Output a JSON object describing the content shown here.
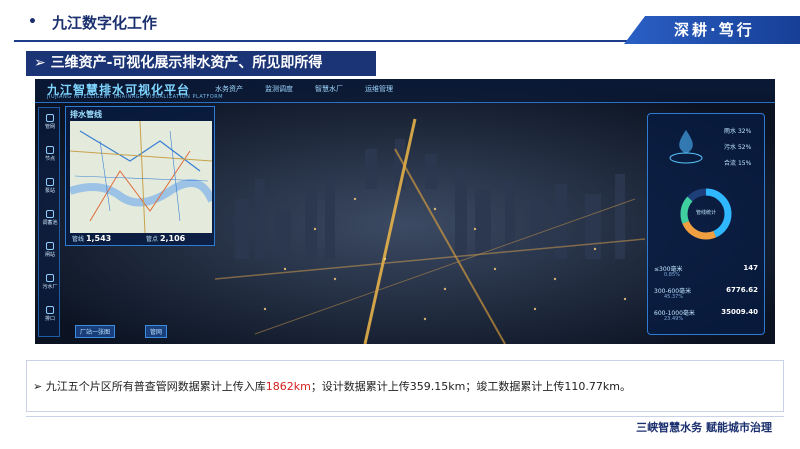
{
  "header": {
    "bullet": "•",
    "title": "九江数字化工作",
    "tag": "深耕·笃行"
  },
  "section": {
    "arrow": "➢",
    "title": "三维资产-可视化展示排水资产、所见即所得"
  },
  "screenshot": {
    "platform_title": "九江智慧排水可视化平台",
    "platform_subtitle": "JIUJIANG INTELLIGENT DRAINAGE VISUALIZATION PLATFORM",
    "nav": [
      "水务资产",
      "监测调度",
      "智慧水厂",
      "运维管理"
    ],
    "sidebar": [
      "管网",
      "节点",
      "泵站",
      "调蓄池",
      "闸站",
      "污水厂",
      "排口"
    ],
    "map_panel": {
      "title": "排水管线",
      "stats": [
        {
          "label": "管线",
          "value": "1,543"
        },
        {
          "label": "管点",
          "value": "2,106"
        }
      ]
    },
    "chips": [
      "厂站一张图",
      "管网"
    ],
    "right_panel": {
      "stats": [
        {
          "label": "雨水",
          "value": "32%"
        },
        {
          "label": "污水",
          "value": "52%"
        },
        {
          "label": "合流",
          "value": "15%"
        }
      ],
      "donut_label": "管线统计",
      "rows": [
        {
          "label": "≤300毫米",
          "value": "147",
          "pct": "0.85%"
        },
        {
          "label": "300-600毫米",
          "value": "6776.62",
          "pct": "45.37%"
        },
        {
          "label": "600-1000毫米",
          "value": "35009.40",
          "pct": "23.49%"
        }
      ]
    }
  },
  "caption": {
    "bullet": "➢",
    "text_before": "九江五个片区所有普查管网数据累计上传入库",
    "highlight": "1862km",
    "text_after": "；设计数据累计上传359.15km；竣工数据累计上传110.77km。"
  },
  "footer": {
    "text": "三峡智慧水务 赋能城市治理"
  },
  "colors": {
    "primary": "#1b3475",
    "highlight": "#d42020"
  }
}
